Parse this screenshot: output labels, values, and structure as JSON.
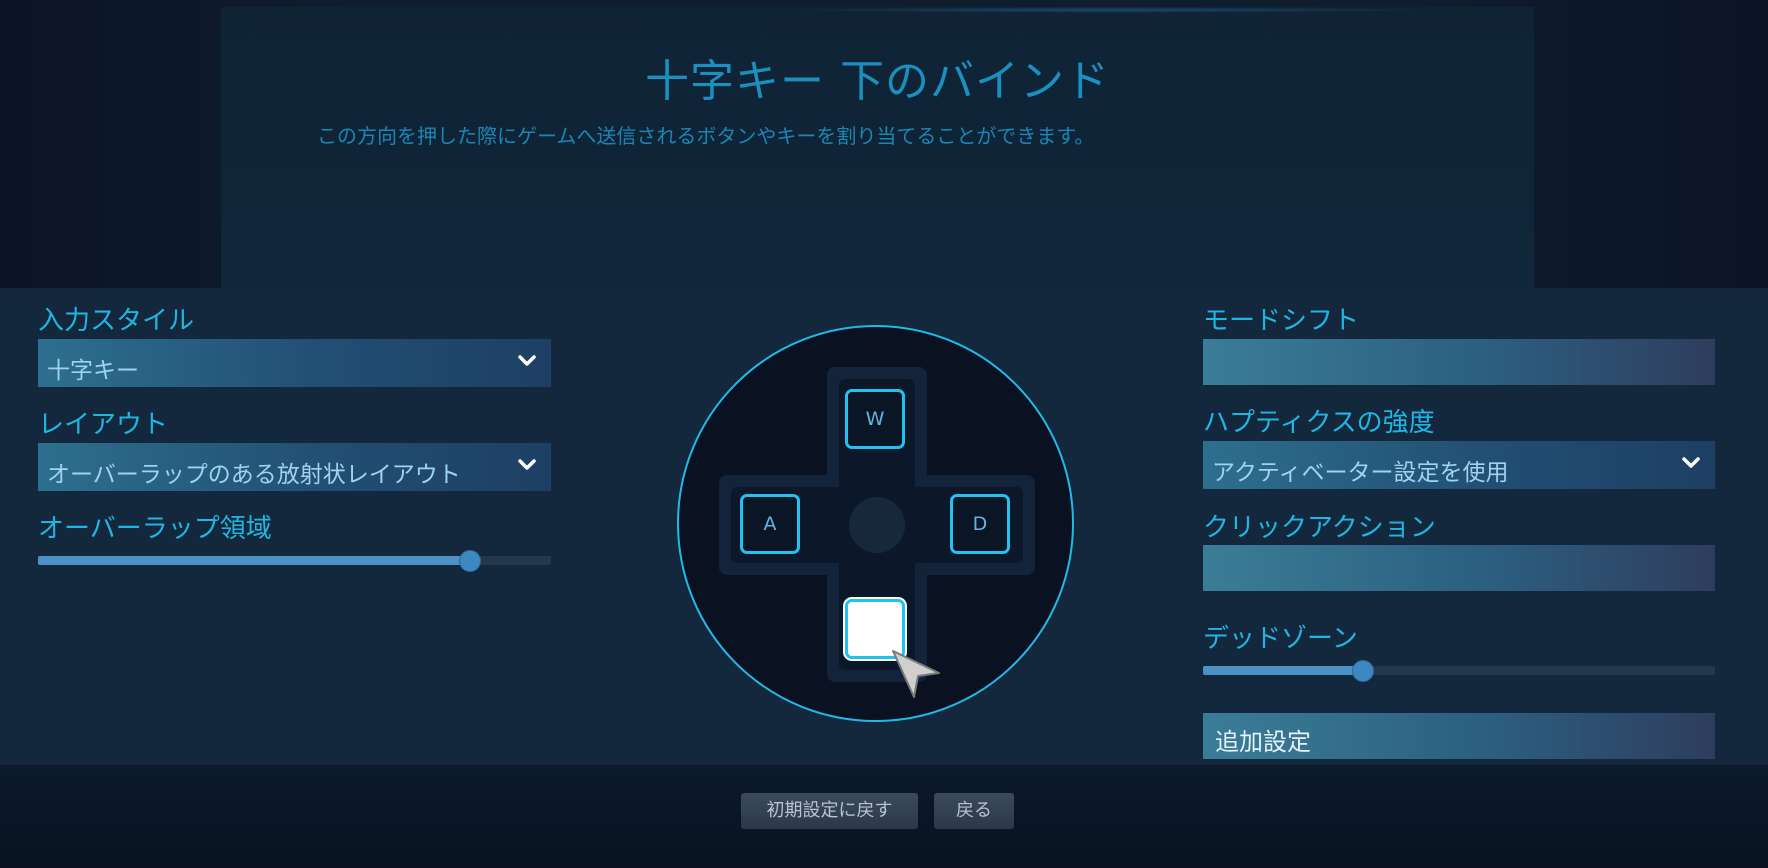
{
  "header": {
    "title": "十字キー 下のバインド",
    "description": "この方向を押した際にゲームへ送信されるボタンやキーを割り当てることができます。"
  },
  "left": {
    "input_style": {
      "label": "入力スタイル",
      "value": "十字キー"
    },
    "layout": {
      "label": "レイアウト",
      "value": "オーバーラップのある放射状レイアウト"
    },
    "overlap_region": {
      "label": "オーバーラップ領域",
      "value_fraction": 0.84
    }
  },
  "dpad": {
    "up_key": "W",
    "left_key": "A",
    "right_key": "D",
    "down_key": ""
  },
  "right": {
    "mode_shift": {
      "label": "モードシフト",
      "value": ""
    },
    "haptics": {
      "label": "ハプティクスの強度",
      "value": "アクティベーター設定を使用"
    },
    "click_action": {
      "label": "クリックアクション",
      "value": ""
    },
    "deadzone": {
      "label": "デッドゾーン",
      "value_fraction": 0.31
    },
    "extra_settings": "追加設定"
  },
  "footer": {
    "reset_label": "初期設定に戻す",
    "back_label": "戻る"
  },
  "colors": {
    "accent": "#1fb6e4",
    "panel": "#14283d",
    "key_border": "#22c2f0"
  },
  "icons": [
    "chevron-down-icon",
    "pointer-cursor-icon"
  ]
}
